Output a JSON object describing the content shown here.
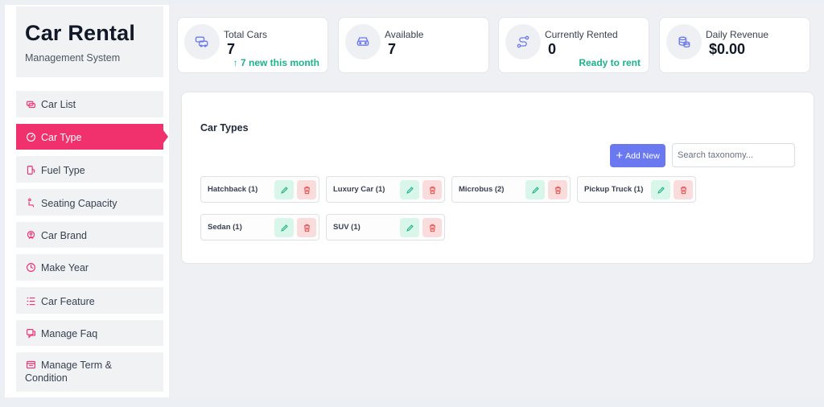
{
  "brand": {
    "title": "Car Rental",
    "subtitle": "Management System"
  },
  "sidebar": {
    "items": [
      {
        "label": "Car List",
        "icon": "car-list-icon"
      },
      {
        "label": "Car Type",
        "icon": "gauge-icon",
        "active": true
      },
      {
        "label": "Fuel Type",
        "icon": "fuel-icon"
      },
      {
        "label": "Seating Capacity",
        "icon": "seat-icon"
      },
      {
        "label": "Car Brand",
        "icon": "brand-badge-icon"
      },
      {
        "label": "Make Year",
        "icon": "clock-icon"
      },
      {
        "label": "Car Feature",
        "icon": "feature-list-icon"
      },
      {
        "label": "Manage Faq",
        "icon": "faq-icon"
      },
      {
        "label": "Manage Term &",
        "label2": "Condition",
        "icon": "terms-icon"
      }
    ]
  },
  "stats": [
    {
      "label": "Total Cars",
      "value": "7",
      "note": "↑ 7 new this month",
      "icon": "cars-icon"
    },
    {
      "label": "Available",
      "value": "7",
      "note": "",
      "icon": "car-front-icon"
    },
    {
      "label": "Currently Rented",
      "value": "0",
      "note": "Ready to rent",
      "icon": "route-icon"
    },
    {
      "label": "Daily Revenue",
      "value": "$0.00",
      "note": "",
      "icon": "coins-icon"
    }
  ],
  "car_types": {
    "title": "Car Types",
    "add_label": "Add New",
    "search_placeholder": "Search taxonomy...",
    "items": [
      {
        "name": "Hatchback (1)"
      },
      {
        "name": "Luxury Car (1)"
      },
      {
        "name": "Microbus (2)"
      },
      {
        "name": "Pickup Truck (1)"
      },
      {
        "name": "Sedan (1)"
      },
      {
        "name": "SUV (1)"
      }
    ]
  },
  "colors": {
    "accent": "#f1306e",
    "primary": "#6a79f0",
    "success": "#1db48a",
    "danger": "#e05252"
  }
}
